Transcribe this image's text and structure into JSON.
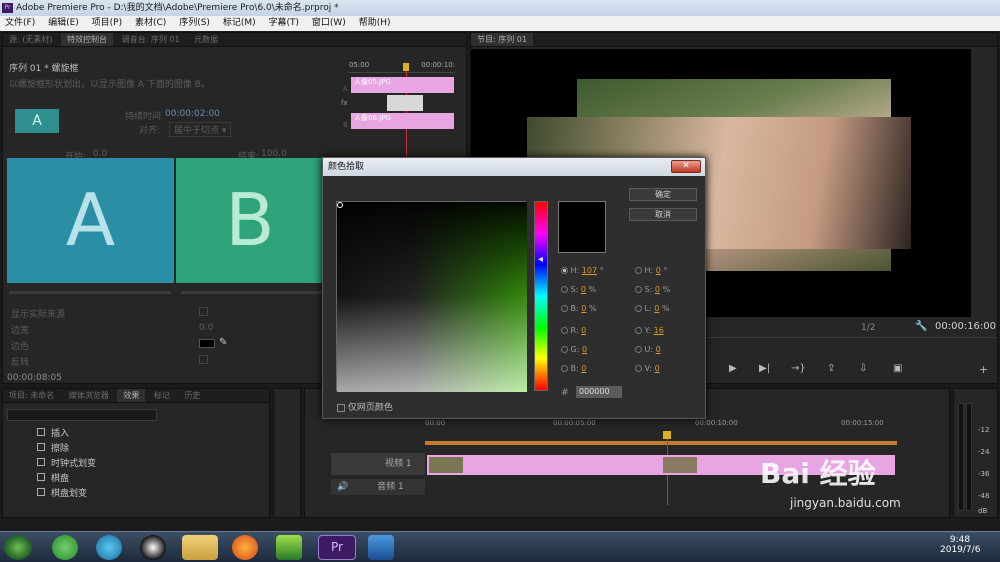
{
  "window": {
    "title": "Adobe Premiere Pro - D:\\我的文档\\Adobe\\Premiere Pro\\6.0\\未命名.prproj *",
    "app_badge": "Pr"
  },
  "menu": [
    "文件(F)",
    "编辑(E)",
    "项目(P)",
    "素材(C)",
    "序列(S)",
    "标记(M)",
    "字幕(T)",
    "窗口(W)",
    "帮助(H)"
  ],
  "effect_controls": {
    "tabs": [
      "源: (无素材)",
      "特效控制台",
      "调音台: 序列 01",
      "元数据"
    ],
    "header": "序列 01 * 螺旋框",
    "description": "以螺旋框形状划出，以显示图像 A 下面的图像 B。",
    "duration_label": "持续时间",
    "duration_value": "00:00:02:00",
    "align_label": "对齐:",
    "align_value": "居中于切点",
    "start_label": "开始:",
    "start_value": "0.0",
    "end_label": "结束:",
    "end_value": "100.0",
    "preview_a": "A",
    "preview_b": "B",
    "a_thumb": "A",
    "show_actual": "显示实际来源",
    "border_width_label": "边宽",
    "border_width_value": "0.0",
    "border_color_label": "边色",
    "reverse_label": "反转",
    "timecode": "00:00:08:05",
    "mini_ruler_time": "05:00",
    "mini_ruler_end": "00:00:10:",
    "mini_clip1": "人像05.JPG",
    "mini_clip2": "人像06.JPG",
    "fx_label": "fx",
    "track_a": "A",
    "track_b": "B"
  },
  "program_monitor": {
    "tab": "节目: 序列 01",
    "zoom": "1/2",
    "timecode": "00:00:16:00"
  },
  "project_panel": {
    "tabs": [
      "项目: 未命名",
      "媒体浏览器",
      "效果",
      "标记",
      "历史"
    ],
    "items": [
      "插入",
      "擦除",
      "时钟式划变",
      "棋盘",
      "棋盘划变"
    ]
  },
  "timeline": {
    "times": [
      "00:00",
      "00:00:05:00",
      "00:00:10:00",
      "00:00:15:00"
    ],
    "video_track": "视频 1",
    "audio_track": "音频 1"
  },
  "color_dialog": {
    "title": "颜色拾取",
    "ok": "确定",
    "cancel": "取消",
    "hsb": {
      "H": "107",
      "S": "0",
      "B": "0"
    },
    "hsl": {
      "H": "0",
      "S": "0",
      "L": "0"
    },
    "rgb": {
      "R": "0",
      "G": "0",
      "B": "0"
    },
    "yuv": {
      "Y": "16",
      "U": "0",
      "V": "0"
    },
    "deg": "°",
    "pct": "%",
    "hex_label": "#",
    "hex_value": "000000",
    "web_only_label": "仅网页颜色",
    "selected_hue": 107,
    "hue_color": "#3ec900"
  },
  "audio_meter": {
    "levels": [
      "-12",
      "-24",
      "-36",
      "-48",
      "dB"
    ]
  },
  "taskbar": {
    "time": "9:48",
    "date": "2019/7/6",
    "pr_label": "Pr"
  },
  "watermark": {
    "brand": "Bai  经验",
    "url": "jingyan.baidu.com"
  }
}
